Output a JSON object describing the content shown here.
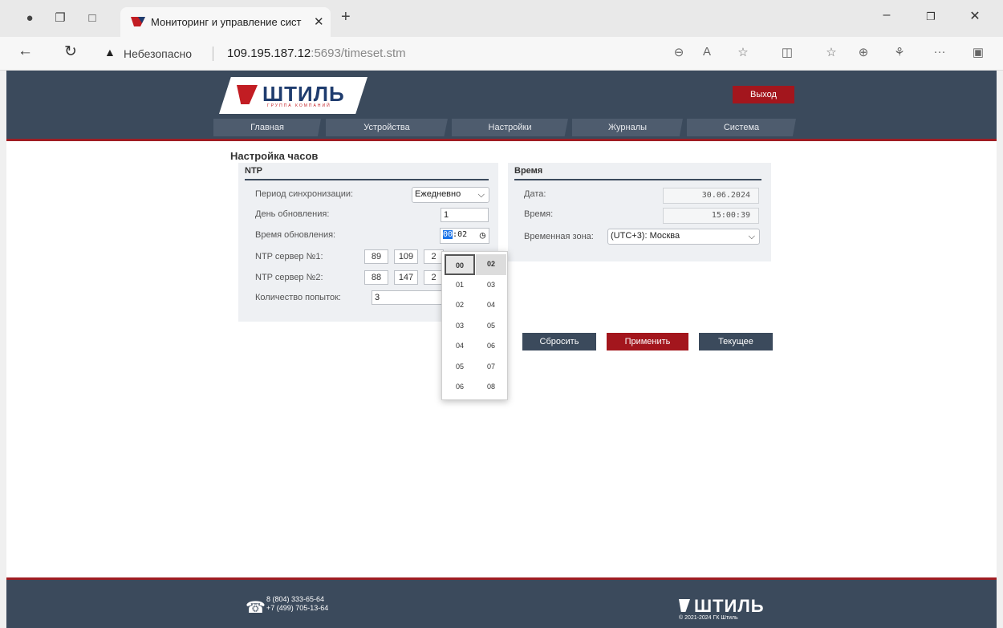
{
  "browser": {
    "tab_title": "Мониторинг и управление сист",
    "address_warning": "Небезопасно",
    "url_host": "109.195.187.12",
    "url_port_path": ":5693/timeset.stm"
  },
  "header": {
    "logo_text": "ШТИЛЬ",
    "logo_sub": "ГРУППА КОМПАНИЙ",
    "logout": "Выход",
    "menu": [
      "Главная",
      "Устройства",
      "Настройки",
      "Журналы",
      "Система"
    ]
  },
  "page_title": "Настройка часов",
  "ntp": {
    "heading": "NTP",
    "sync_period_label": "Период синхронизации:",
    "sync_period_value": "Ежедневно",
    "update_day_label": "День обновления:",
    "update_day_value": "1",
    "update_time_label": "Время обновления:",
    "update_time_hh": "00",
    "update_time_sep": ":",
    "update_time_mm": "02",
    "server1_label": "NTP сервер №1:",
    "server1": [
      "89",
      "109",
      "2"
    ],
    "server2_label": "NTP сервер №2:",
    "server2": [
      "88",
      "147",
      "2"
    ],
    "retries_label": "Количество попыток:",
    "retries_value": "3"
  },
  "time": {
    "heading": "Время",
    "date_label": "Дата:",
    "date_value": "30.06.2024",
    "time_label": "Время:",
    "time_value": "15:00:39",
    "tz_label": "Временная зона:",
    "tz_value": "(UTC+3): Москва"
  },
  "buttons": {
    "reset": "Сбросить",
    "apply": "Применить",
    "current": "Текущее"
  },
  "picker": {
    "hours": [
      "00",
      "01",
      "02",
      "03",
      "04",
      "05",
      "06"
    ],
    "minutes": [
      "02",
      "03",
      "04",
      "05",
      "06",
      "07",
      "08"
    ]
  },
  "footer": {
    "phone1": "8 (804) 333-65-64",
    "phone2": "+7 (499) 705-13-64",
    "logo": "ШТИЛЬ",
    "copyright": "© 2021-2024 ГК Штиль"
  },
  "colors": {
    "header": "#3b4a5c",
    "accent": "#9f1d23",
    "button_dark": "#3b4a5c",
    "button_red": "#a3161d"
  }
}
